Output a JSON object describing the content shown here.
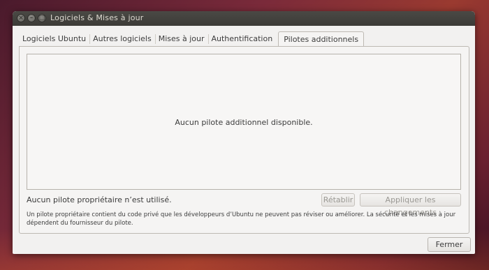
{
  "window": {
    "title": "Logiciels & Mises à jour",
    "controls": {
      "close": "×",
      "minimize": "–",
      "maximize": "□"
    }
  },
  "tabs": [
    {
      "label": "Logiciels Ubuntu",
      "active": false
    },
    {
      "label": "Autres logiciels",
      "active": false
    },
    {
      "label": "Mises à jour",
      "active": false
    },
    {
      "label": "Authentification",
      "active": false
    },
    {
      "label": "Pilotes additionnels",
      "active": true
    }
  ],
  "drivers": {
    "empty_message": "Aucun pilote additionnel disponible.",
    "status": "Aucun pilote propriétaire n’est utilisé.",
    "revert_label": "Rétablir",
    "apply_label": "Appliquer les changements",
    "note_line1": "Un pilote propriétaire contient du code privé que les développeurs d’Ubuntu ne peuvent pas réviser ou améliorer. La sécurité et les mises à jour",
    "note_line2": "dépendent du fournisseur du pilote."
  },
  "footer": {
    "close_label": "Fermer"
  }
}
